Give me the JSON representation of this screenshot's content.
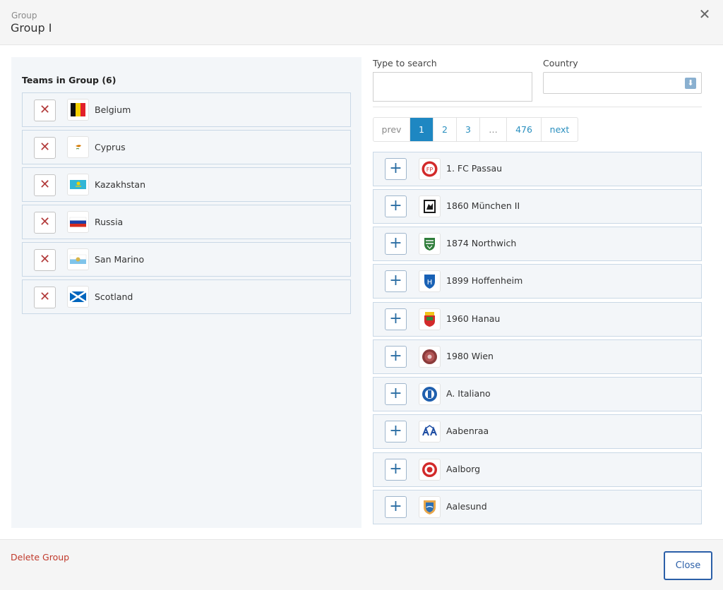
{
  "header": {
    "subtitle": "Group",
    "title": "Group I",
    "close_icon": "✕"
  },
  "left": {
    "title": "Teams in Group (6)",
    "teams": [
      {
        "name": "Belgium",
        "remove_label": "✕",
        "icon": "belgium-flag-icon"
      },
      {
        "name": "Cyprus",
        "remove_label": "✕",
        "icon": "cyprus-flag-icon"
      },
      {
        "name": "Kazakhstan",
        "remove_label": "✕",
        "icon": "kazakhstan-flag-icon"
      },
      {
        "name": "Russia",
        "remove_label": "✕",
        "icon": "russia-flag-icon"
      },
      {
        "name": "San Marino",
        "remove_label": "✕",
        "icon": "san-marino-flag-icon"
      },
      {
        "name": "Scotland",
        "remove_label": "✕",
        "icon": "scotland-flag-icon"
      }
    ]
  },
  "search": {
    "label": "Type to search",
    "value": "",
    "placeholder": ""
  },
  "country": {
    "label": "Country",
    "value": "",
    "arrow": "⬇"
  },
  "pagination": [
    "prev",
    "1",
    "2",
    "3",
    "…",
    "476",
    "next"
  ],
  "pagination_active": "1",
  "clubs": [
    {
      "name": "1. FC Passau",
      "add_label": "+",
      "icon": "fc-passau-logo-icon"
    },
    {
      "name": "1860 München II",
      "add_label": "+",
      "icon": "1860-muenchen-logo-icon"
    },
    {
      "name": "1874 Northwich",
      "add_label": "+",
      "icon": "1874-northwich-logo-icon"
    },
    {
      "name": "1899 Hoffenheim",
      "add_label": "+",
      "icon": "hoffenheim-logo-icon"
    },
    {
      "name": "1960 Hanau",
      "add_label": "+",
      "icon": "hanau-logo-icon"
    },
    {
      "name": "1980 Wien",
      "add_label": "+",
      "icon": "wien-logo-icon"
    },
    {
      "name": "A. Italiano",
      "add_label": "+",
      "icon": "a-italiano-logo-icon"
    },
    {
      "name": "Aabenraa",
      "add_label": "+",
      "icon": "aabenraa-logo-icon"
    },
    {
      "name": "Aalborg",
      "add_label": "+",
      "icon": "aalborg-logo-icon"
    },
    {
      "name": "Aalesund",
      "add_label": "+",
      "icon": "aalesund-logo-icon"
    }
  ],
  "footer": {
    "delete_label": "Delete Group",
    "close_label": "Close"
  },
  "colors": {
    "accent": "#1e87c2",
    "danger": "#c0392b",
    "row_bg": "#f3f6f9",
    "row_border": "#c9d8e6"
  }
}
